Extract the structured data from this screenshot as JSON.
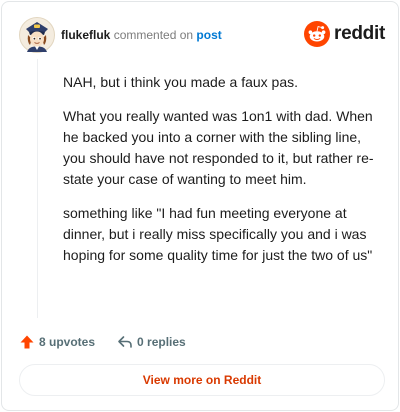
{
  "comment": {
    "author": "flukefluk",
    "action_text": "commented on",
    "post_link": "post",
    "paragraphs": [
      "NAH, but i think you made a faux pas.",
      "What you really wanted was 1on1 with dad. When he backed you into a corner with the sibling line, you should have not responded to it, but rather re-state your case of wanting to meet him.",
      "something like \"I had fun meeting everyone at dinner, but i really miss specifically you and i was hoping for some quality time for just the two of us\""
    ]
  },
  "brand": {
    "wordmark": "reddit",
    "color": "#ff4500",
    "icon": "reddit-snoo-icon"
  },
  "actions": {
    "upvotes": "8 upvotes",
    "upvote_icon": "upvote-arrow-icon",
    "replies": "0 replies",
    "reply_icon": "reply-arrow-icon"
  },
  "cta": {
    "label": "View more on Reddit",
    "color": "#d93900"
  }
}
